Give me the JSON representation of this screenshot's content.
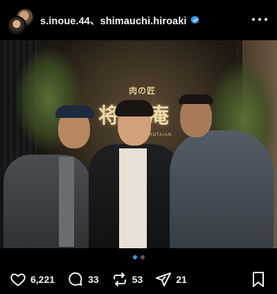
{
  "header": {
    "usernames": "s.inoue.44、shimauchi.hiroaki",
    "verified_icon": "verified-badge-icon",
    "more_icon": "more-options-icon"
  },
  "photo": {
    "sign_sub": "肉の匠",
    "sign_main": "将泰庵",
    "sign_small": "SHOTAIAN",
    "description_icon": "post-photo"
  },
  "carousel": {
    "total": 2,
    "active_index": 0
  },
  "actions": {
    "likes": "6,221",
    "comments": "33",
    "reposts": "53",
    "shares": "21"
  },
  "colors": {
    "background": "#000000",
    "text": "#f5f5f5",
    "verified": "#3897f0",
    "dot_active": "#3897f0",
    "dot_inactive": "#5a5a5a"
  }
}
